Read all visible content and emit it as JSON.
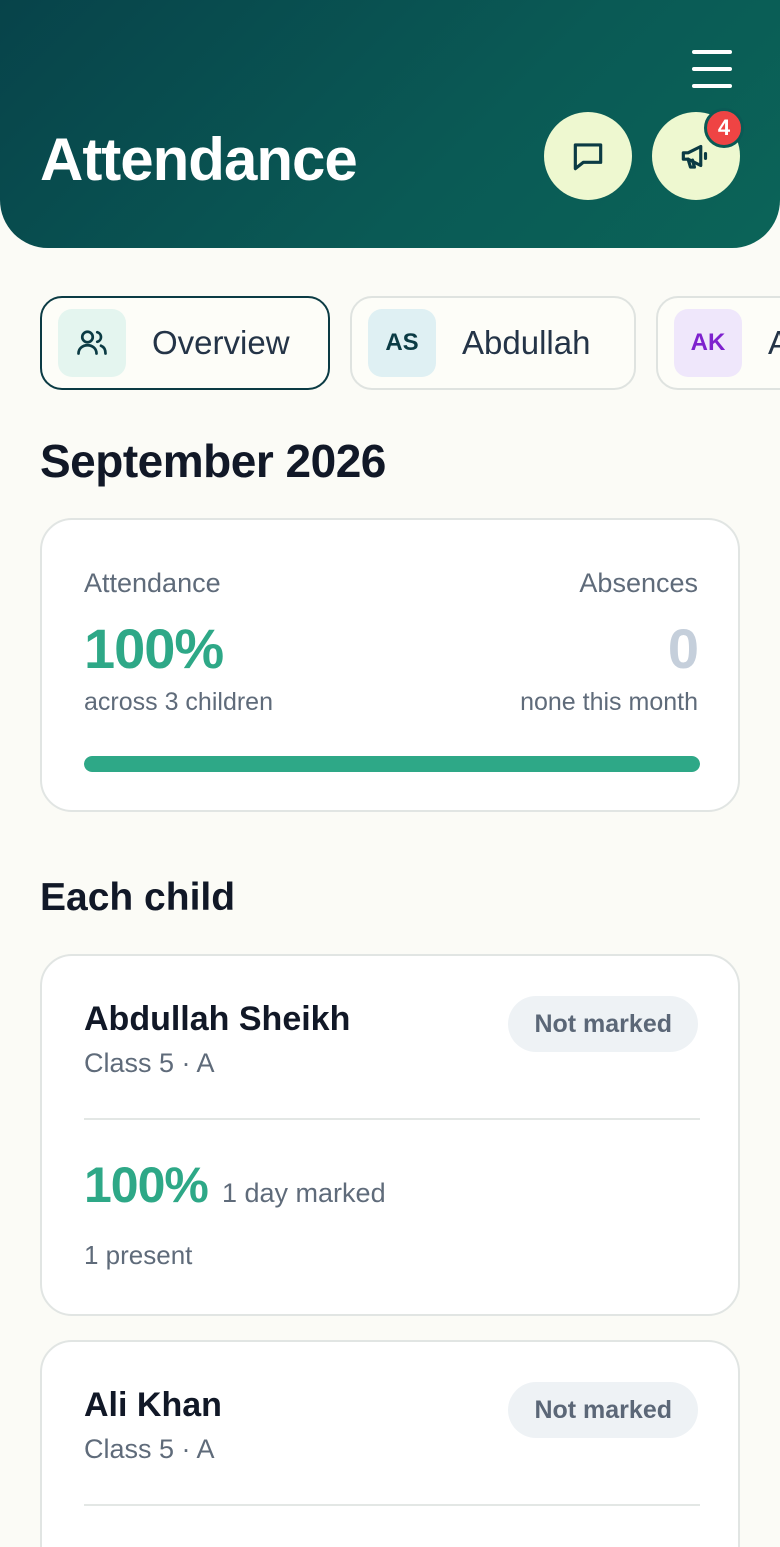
{
  "header": {
    "title": "Attendance",
    "notification_count": "4",
    "icons": [
      "menu-icon",
      "chat-icon",
      "megaphone-icon"
    ]
  },
  "tabs": [
    {
      "label": "Overview",
      "icon": "users-icon",
      "active": true
    },
    {
      "label": "Abdullah",
      "initials": "AS",
      "avatar_bg": "#dff0f3",
      "avatar_fg": "#0b3b44"
    },
    {
      "label": "Ali",
      "initials": "AK",
      "avatar_bg": "#efe7fb",
      "avatar_fg": "#7e22ce"
    }
  ],
  "month": "September 2026",
  "summary": {
    "attendance_label": "Attendance",
    "attendance_value": "100%",
    "attendance_sub": "across 3 children",
    "absences_label": "Absences",
    "absences_value": "0",
    "absences_sub": "none this month",
    "progress_percent": 100
  },
  "section_title": "Each child",
  "children": [
    {
      "name": "Abdullah Sheikh",
      "class": "Class 5 · A",
      "status": "Not marked",
      "percent": "100%",
      "marked": "1 day marked",
      "present": "1 present"
    },
    {
      "name": "Ali Khan",
      "class": "Class 5 · A",
      "status": "Not marked"
    }
  ],
  "colors": {
    "accent_green": "#2ea887",
    "header_dark": "#07434a",
    "badge_red": "#ef4444",
    "circle_btn_bg": "#eef8d0"
  }
}
